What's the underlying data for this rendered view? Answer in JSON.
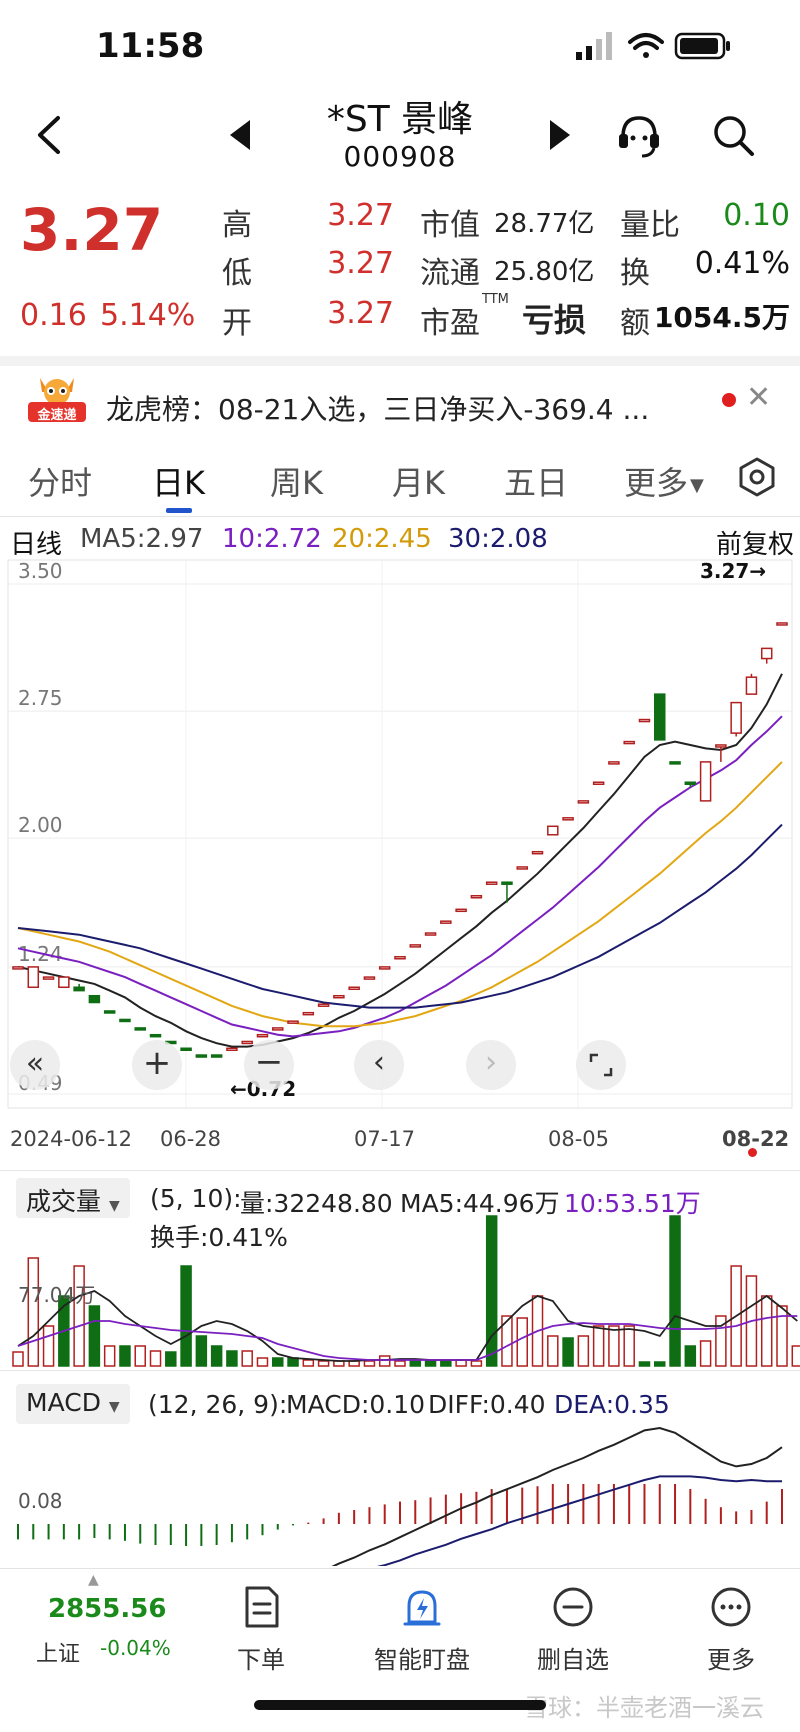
{
  "status": {
    "time": "11:58"
  },
  "header": {
    "name": "*ST 景峰",
    "code": "000908"
  },
  "quote": {
    "price": "3.27",
    "change": "0.16",
    "change_pct": "5.14%",
    "high_label": "高",
    "high": "3.27",
    "low_label": "低",
    "low": "3.27",
    "open_label": "开",
    "open": "3.27",
    "mktcap_label": "市值",
    "mktcap": "28.77亿",
    "float_label": "流通",
    "float": "25.80亿",
    "pe_label": "市盈",
    "pe_sup": "TTM",
    "pe": "亏损",
    "volratio_label": "量比",
    "volratio": "0.10",
    "turnover_label": "换",
    "turnover": "0.41%",
    "amount_label": "额",
    "amount": "1054.5万"
  },
  "lhb": {
    "logo_text": "金速递",
    "text": "龙虎榜：08-21入选，三日净买入-369.4 ..."
  },
  "tabs": [
    "分时",
    "日K",
    "周K",
    "月K",
    "五日",
    "更多"
  ],
  "active_tab": 1,
  "ma_legend": {
    "label": "日线",
    "ma5": "MA5:2.97",
    "ma10": "10:2.72",
    "ma20": "20:2.45",
    "ma30": "30:2.08",
    "adjust": "前复权"
  },
  "colors": {
    "up": "#b21f1f",
    "down": "#0f6e14",
    "ma5": "#222222",
    "ma10": "#7a1fc0",
    "ma20": "#e2a712",
    "ma30": "#1c1c6e",
    "accent": "#2255cc"
  },
  "chart_data": [
    {
      "type": "candlestick",
      "y_ticks": [
        "3.50",
        "2.75",
        "2.00",
        "1.24",
        "0.49"
      ],
      "ylim": [
        0.49,
        3.5
      ],
      "x_labels": [
        "2024-06-12",
        "06-28",
        "07-17",
        "08-05",
        "08-22"
      ],
      "max_label": "3.27→",
      "min_label": "←0.72",
      "candles": [
        {
          "o": 1.24,
          "c": 1.24,
          "h": 1.24,
          "l": 1.24,
          "up": true
        },
        {
          "o": 1.24,
          "c": 1.12,
          "h": 1.24,
          "l": 1.12,
          "up": true
        },
        {
          "o": 1.18,
          "c": 1.18,
          "h": 1.18,
          "l": 1.18,
          "up": true
        },
        {
          "o": 1.18,
          "c": 1.12,
          "h": 1.18,
          "l": 1.12,
          "up": true
        },
        {
          "o": 1.12,
          "c": 1.1,
          "h": 1.14,
          "l": 1.1,
          "up": false
        },
        {
          "o": 1.07,
          "c": 1.03,
          "h": 1.07,
          "l": 1.03,
          "up": false
        },
        {
          "o": 0.98,
          "c": 0.98,
          "h": 0.98,
          "l": 0.98,
          "up": false
        },
        {
          "o": 0.93,
          "c": 0.93,
          "h": 0.93,
          "l": 0.93,
          "up": false
        },
        {
          "o": 0.88,
          "c": 0.88,
          "h": 0.88,
          "l": 0.88,
          "up": false
        },
        {
          "o": 0.84,
          "c": 0.84,
          "h": 0.84,
          "l": 0.84,
          "up": false
        },
        {
          "o": 0.8,
          "c": 0.8,
          "h": 0.8,
          "l": 0.8,
          "up": false
        },
        {
          "o": 0.76,
          "c": 0.76,
          "h": 0.76,
          "l": 0.76,
          "up": false
        },
        {
          "o": 0.72,
          "c": 0.72,
          "h": 0.72,
          "l": 0.72,
          "up": false
        },
        {
          "o": 0.72,
          "c": 0.72,
          "h": 0.72,
          "l": 0.72,
          "up": false
        },
        {
          "o": 0.76,
          "c": 0.76,
          "h": 0.76,
          "l": 0.76,
          "up": true
        },
        {
          "o": 0.8,
          "c": 0.8,
          "h": 0.8,
          "l": 0.8,
          "up": true
        },
        {
          "o": 0.84,
          "c": 0.84,
          "h": 0.84,
          "l": 0.84,
          "up": true
        },
        {
          "o": 0.88,
          "c": 0.88,
          "h": 0.88,
          "l": 0.88,
          "up": true
        },
        {
          "o": 0.92,
          "c": 0.92,
          "h": 0.92,
          "l": 0.92,
          "up": true
        },
        {
          "o": 0.97,
          "c": 0.97,
          "h": 0.97,
          "l": 0.97,
          "up": true
        },
        {
          "o": 1.02,
          "c": 1.02,
          "h": 1.02,
          "l": 1.02,
          "up": true
        },
        {
          "o": 1.07,
          "c": 1.07,
          "h": 1.07,
          "l": 1.07,
          "up": true
        },
        {
          "o": 1.12,
          "c": 1.12,
          "h": 1.12,
          "l": 1.12,
          "up": true
        },
        {
          "o": 1.18,
          "c": 1.18,
          "h": 1.18,
          "l": 1.18,
          "up": true
        },
        {
          "o": 1.24,
          "c": 1.24,
          "h": 1.24,
          "l": 1.24,
          "up": true
        },
        {
          "o": 1.3,
          "c": 1.3,
          "h": 1.3,
          "l": 1.3,
          "up": true
        },
        {
          "o": 1.37,
          "c": 1.37,
          "h": 1.37,
          "l": 1.37,
          "up": true
        },
        {
          "o": 1.44,
          "c": 1.44,
          "h": 1.44,
          "l": 1.44,
          "up": true
        },
        {
          "o": 1.51,
          "c": 1.51,
          "h": 1.51,
          "l": 1.51,
          "up": true
        },
        {
          "o": 1.58,
          "c": 1.58,
          "h": 1.58,
          "l": 1.58,
          "up": true
        },
        {
          "o": 1.66,
          "c": 1.66,
          "h": 1.66,
          "l": 1.66,
          "up": true
        },
        {
          "o": 1.74,
          "c": 1.74,
          "h": 1.74,
          "l": 1.74,
          "up": true
        },
        {
          "o": 1.74,
          "c": 1.74,
          "h": 1.74,
          "l": 1.62,
          "up": false
        },
        {
          "o": 1.83,
          "c": 1.83,
          "h": 1.83,
          "l": 1.83,
          "up": true
        },
        {
          "o": 1.92,
          "c": 1.92,
          "h": 1.92,
          "l": 1.92,
          "up": true
        },
        {
          "o": 2.02,
          "c": 2.07,
          "h": 2.07,
          "l": 2.02,
          "up": true
        },
        {
          "o": 2.12,
          "c": 2.12,
          "h": 2.12,
          "l": 2.12,
          "up": true
        },
        {
          "o": 2.22,
          "c": 2.22,
          "h": 2.22,
          "l": 2.22,
          "up": true
        },
        {
          "o": 2.33,
          "c": 2.33,
          "h": 2.33,
          "l": 2.33,
          "up": true
        },
        {
          "o": 2.45,
          "c": 2.45,
          "h": 2.45,
          "l": 2.45,
          "up": true
        },
        {
          "o": 2.57,
          "c": 2.57,
          "h": 2.57,
          "l": 2.57,
          "up": true
        },
        {
          "o": 2.7,
          "c": 2.7,
          "h": 2.7,
          "l": 2.7,
          "up": true
        },
        {
          "o": 2.85,
          "c": 2.58,
          "h": 2.85,
          "l": 2.58,
          "up": false
        },
        {
          "o": 2.45,
          "c": 2.45,
          "h": 2.45,
          "l": 2.45,
          "up": false
        },
        {
          "o": 2.33,
          "c": 2.33,
          "h": 2.33,
          "l": 2.3,
          "up": false
        },
        {
          "o": 2.22,
          "c": 2.45,
          "h": 2.45,
          "l": 2.22,
          "up": true
        },
        {
          "o": 2.55,
          "c": 2.55,
          "h": 2.55,
          "l": 2.45,
          "up": true
        },
        {
          "o": 2.62,
          "c": 2.8,
          "h": 2.8,
          "l": 2.6,
          "up": true
        },
        {
          "o": 2.85,
          "c": 2.95,
          "h": 2.97,
          "l": 2.85,
          "up": true
        },
        {
          "o": 3.06,
          "c": 3.12,
          "h": 3.12,
          "l": 3.03,
          "up": true
        },
        {
          "o": 3.27,
          "c": 3.27,
          "h": 3.27,
          "l": 3.27,
          "up": true
        }
      ],
      "series": [
        {
          "name": "MA5",
          "values": [
            1.24,
            1.22,
            1.2,
            1.18,
            1.16,
            1.14,
            1.1,
            1.06,
            1.0,
            0.95,
            0.91,
            0.86,
            0.82,
            0.79,
            0.77,
            0.77,
            0.78,
            0.8,
            0.82,
            0.85,
            0.89,
            0.94,
            0.98,
            1.03,
            1.08,
            1.14,
            1.2,
            1.27,
            1.34,
            1.41,
            1.48,
            1.56,
            1.63,
            1.71,
            1.79,
            1.88,
            1.97,
            2.06,
            2.16,
            2.26,
            2.37,
            2.48,
            2.55,
            2.57,
            2.55,
            2.53,
            2.52,
            2.55,
            2.65,
            2.79,
            2.97
          ]
        },
        {
          "name": "10",
          "values": [
            1.35,
            1.33,
            1.31,
            1.29,
            1.27,
            1.24,
            1.21,
            1.18,
            1.14,
            1.1,
            1.06,
            1.02,
            0.98,
            0.94,
            0.9,
            0.88,
            0.86,
            0.84,
            0.83,
            0.84,
            0.85,
            0.86,
            0.88,
            0.91,
            0.94,
            0.98,
            1.03,
            1.08,
            1.13,
            1.19,
            1.25,
            1.31,
            1.38,
            1.45,
            1.52,
            1.59,
            1.67,
            1.75,
            1.83,
            1.92,
            2.01,
            2.1,
            2.18,
            2.24,
            2.3,
            2.35,
            2.4,
            2.46,
            2.55,
            2.63,
            2.72
          ]
        },
        {
          "name": "20",
          "values": [
            1.47,
            1.45,
            1.43,
            1.41,
            1.39,
            1.36,
            1.33,
            1.29,
            1.25,
            1.21,
            1.17,
            1.13,
            1.09,
            1.05,
            1.01,
            0.98,
            0.95,
            0.93,
            0.91,
            0.9,
            0.89,
            0.89,
            0.89,
            0.9,
            0.91,
            0.93,
            0.95,
            0.98,
            1.01,
            1.04,
            1.08,
            1.12,
            1.17,
            1.22,
            1.27,
            1.33,
            1.39,
            1.45,
            1.51,
            1.58,
            1.65,
            1.72,
            1.79,
            1.87,
            1.95,
            2.03,
            2.1,
            2.18,
            2.27,
            2.36,
            2.45
          ]
        },
        {
          "name": "30",
          "values": [
            1.47,
            1.46,
            1.45,
            1.44,
            1.43,
            1.41,
            1.39,
            1.37,
            1.35,
            1.32,
            1.29,
            1.26,
            1.23,
            1.2,
            1.17,
            1.14,
            1.11,
            1.09,
            1.07,
            1.05,
            1.03,
            1.02,
            1.01,
            1.0,
            1.0,
            1.0,
            1.0,
            1.01,
            1.02,
            1.03,
            1.05,
            1.07,
            1.09,
            1.12,
            1.15,
            1.18,
            1.22,
            1.26,
            1.3,
            1.35,
            1.4,
            1.45,
            1.5,
            1.56,
            1.62,
            1.68,
            1.75,
            1.82,
            1.9,
            1.99,
            2.08
          ]
        }
      ]
    },
    {
      "type": "bar",
      "title": "成交量",
      "y_tick": "77.04万",
      "ylim": [
        0,
        150
      ],
      "values": [
        14,
        108,
        40,
        70,
        100,
        60,
        20,
        20,
        20,
        15,
        14,
        100,
        30,
        20,
        15,
        15,
        8,
        8,
        8,
        6,
        5,
        5,
        5,
        5,
        10,
        5,
        5,
        5,
        5,
        6,
        5,
        150,
        50,
        48,
        70,
        30,
        28,
        30,
        40,
        40,
        40,
        4,
        4,
        150,
        20,
        25,
        50,
        100,
        90,
        70,
        60,
        20
      ],
      "up": [
        true,
        true,
        true,
        false,
        true,
        false,
        true,
        false,
        true,
        true,
        false,
        false,
        false,
        false,
        false,
        true,
        true,
        false,
        false,
        true,
        true,
        true,
        true,
        true,
        true,
        true,
        false,
        false,
        false,
        true,
        true,
        false,
        true,
        true,
        true,
        true,
        false,
        true,
        true,
        true,
        true,
        false,
        false,
        false,
        false,
        true,
        true,
        true,
        true,
        true,
        true,
        true
      ],
      "series": [
        {
          "name": "MA5",
          "values": [
            20,
            30,
            45,
            60,
            70,
            75,
            65,
            50,
            40,
            30,
            22,
            30,
            40,
            45,
            42,
            35,
            25,
            12,
            8,
            7,
            6,
            5,
            5,
            6,
            6,
            7,
            7,
            6,
            6,
            6,
            6,
            30,
            45,
            60,
            70,
            65,
            45,
            40,
            38,
            36,
            37,
            35,
            30,
            50,
            45,
            40,
            40,
            50,
            60,
            70,
            58,
            45
          ]
        },
        {
          "name": "10",
          "values": [
            20,
            25,
            30,
            35,
            40,
            45,
            45,
            42,
            40,
            38,
            36,
            35,
            34,
            33,
            32,
            30,
            28,
            22,
            18,
            14,
            10,
            8,
            7,
            6,
            6,
            6,
            6,
            6,
            6,
            6,
            6,
            12,
            20,
            28,
            35,
            40,
            42,
            43,
            42,
            42,
            42,
            40,
            38,
            37,
            37,
            37,
            38,
            40,
            45,
            48,
            50,
            50
          ]
        }
      ],
      "info_prefix": "(5, 10):",
      "info_vol": "量:32248.80",
      "info_ma5": "MA5:44.96万",
      "info_ma10": "10:53.51万",
      "info_turnover": "换手:0.41%"
    },
    {
      "type": "bar",
      "title": "MACD",
      "y_tick": "0.08",
      "params": "(12, 26, 9):",
      "macd": "MACD:0.10",
      "diff": "DIFF:0.40",
      "dea": "DEA:0.35"
    }
  ],
  "controls": {
    "zoom_fast_icon": "double-chevron-left-icon",
    "zoom_in_icon": "plus-icon",
    "zoom_out_icon": "minus-icon",
    "prev_icon": "chevron-left-icon",
    "next_icon": "chevron-right-icon",
    "fullscreen_icon": "fullscreen-icon"
  },
  "bottom_nav": {
    "index_value": "2855.56",
    "index_name": "上证",
    "index_change": "-0.04%",
    "items": [
      "下单",
      "智能盯盘",
      "删自选",
      "更多"
    ]
  },
  "watermark": "雪球：半壶老酒一溪云"
}
